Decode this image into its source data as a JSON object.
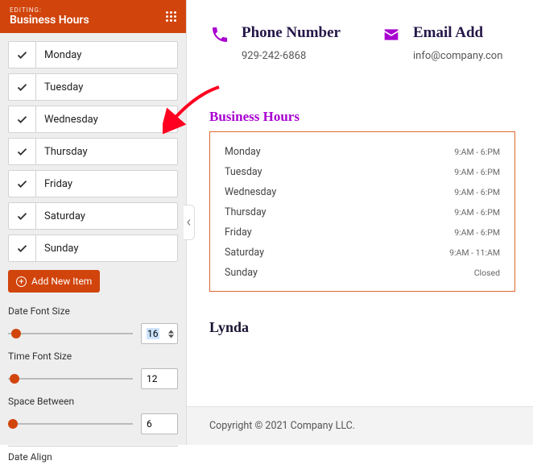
{
  "sidebar": {
    "editing_label": "EDITING:",
    "title": "Business Hours",
    "days": [
      "Monday",
      "Tuesday",
      "Wednesday",
      "Thursday",
      "Friday",
      "Saturday",
      "Sunday"
    ],
    "add_label": "Add New Item",
    "controls": {
      "date_font_label": "Date Font Size",
      "date_font_value": "16",
      "time_font_label": "Time Font Size",
      "time_font_value": "12",
      "space_label": "Space Between",
      "space_value": "6",
      "date_align_label": "Date Align"
    }
  },
  "preview": {
    "phone_heading": "Phone Number",
    "phone_value": "929-242-6868",
    "email_heading": "Email Add",
    "email_value": "info@company.con",
    "bh_heading": "Business Hours",
    "hours": [
      {
        "day": "Monday",
        "time": "9:AM - 6:PM"
      },
      {
        "day": "Tuesday",
        "time": "9:AM - 6:PM"
      },
      {
        "day": "Wednesday",
        "time": "9:AM - 6:PM"
      },
      {
        "day": "Thursday",
        "time": "9:AM - 6:PM"
      },
      {
        "day": "Friday",
        "time": "9:AM - 6:PM"
      },
      {
        "day": "Saturday",
        "time": "9:AM - 11:AM"
      },
      {
        "day": "Sunday",
        "time": "Closed"
      }
    ],
    "author": "Lynda",
    "copyright": "Copyright © 2021 Company LLC."
  }
}
